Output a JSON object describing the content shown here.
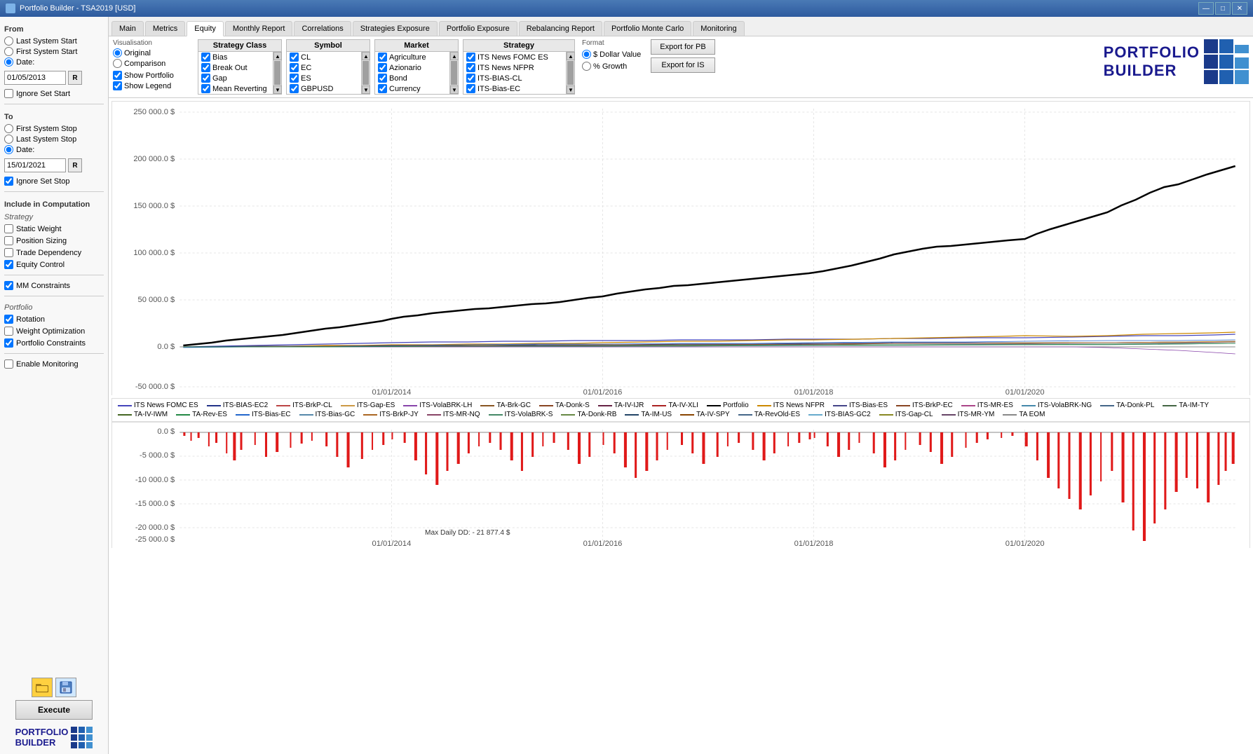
{
  "app": {
    "title": "Portfolio Builder - TSA2019 [USD]",
    "icon": "📊"
  },
  "titlebar": {
    "minimize": "—",
    "maximize": "□",
    "close": "✕"
  },
  "tabs": [
    {
      "label": "Main",
      "active": false
    },
    {
      "label": "Metrics",
      "active": false
    },
    {
      "label": "Equity",
      "active": true
    },
    {
      "label": "Monthly Report",
      "active": false
    },
    {
      "label": "Correlations",
      "active": false
    },
    {
      "label": "Strategies Exposure",
      "active": false
    },
    {
      "label": "Portfolio Exposure",
      "active": false
    },
    {
      "label": "Rebalancing Report",
      "active": false
    },
    {
      "label": "Portfolio Monte Carlo",
      "active": false
    },
    {
      "label": "Monitoring",
      "active": false
    }
  ],
  "left": {
    "from_label": "From",
    "from_options": [
      {
        "label": "Last System Start",
        "checked": true
      },
      {
        "label": "First System Start",
        "checked": false
      },
      {
        "label": "Date:",
        "checked": false
      }
    ],
    "from_date": "01/05/2013",
    "ignore_set_start": "Ignore Set Start",
    "to_label": "To",
    "to_options": [
      {
        "label": "First System Stop",
        "checked": false
      },
      {
        "label": "Last System Stop",
        "checked": false
      },
      {
        "label": "Date:",
        "checked": true
      }
    ],
    "to_date": "15/01/2021",
    "ignore_set_stop": "Ignore Set Stop",
    "include_label": "Include in Computation",
    "strategy_label": "Strategy",
    "strategy_items": [
      {
        "label": "Static Weight",
        "checked": false
      },
      {
        "label": "Position Sizing",
        "checked": false
      },
      {
        "label": "Trade Dependency",
        "checked": false
      },
      {
        "label": "Equity Control",
        "checked": true
      }
    ],
    "mm_label": "MM Constraints",
    "mm_checked": true,
    "portfolio_label": "Portfolio",
    "portfolio_items": [
      {
        "label": "Rotation",
        "checked": true
      },
      {
        "label": "Weight Optimization",
        "checked": false
      },
      {
        "label": "Portfolio Constraints",
        "checked": true
      }
    ],
    "enable_monitoring": "Enable Monitoring",
    "enable_monitoring_checked": false,
    "execute_btn": "Execute"
  },
  "toolbar": {
    "vis_label": "Visualisation",
    "vis_radios": [
      {
        "label": "Original",
        "checked": true
      },
      {
        "label": "Comparison",
        "checked": false
      }
    ],
    "vis_checks": [
      {
        "label": "Show Portfolio",
        "checked": true
      },
      {
        "label": "Show Legend",
        "checked": true
      }
    ],
    "strategy_class": {
      "header": "Strategy Class",
      "items": [
        {
          "label": "Bias",
          "checked": true
        },
        {
          "label": "Break Out",
          "checked": true
        },
        {
          "label": "Gap",
          "checked": true
        },
        {
          "label": "Mean Reverting",
          "checked": true
        }
      ]
    },
    "symbol": {
      "header": "Symbol",
      "items": [
        {
          "label": "CL",
          "checked": true
        },
        {
          "label": "EC",
          "checked": true
        },
        {
          "label": "ES",
          "checked": true
        },
        {
          "label": "GBPUSD",
          "checked": true
        }
      ]
    },
    "market": {
      "header": "Market",
      "items": [
        {
          "label": "Agriculture",
          "checked": true
        },
        {
          "label": "Azionario",
          "checked": true
        },
        {
          "label": "Bond",
          "checked": true
        },
        {
          "label": "Currency",
          "checked": true
        }
      ]
    },
    "strategy": {
      "header": "Strategy",
      "items": [
        {
          "label": "ITS News FOMC ES",
          "checked": true
        },
        {
          "label": "ITS News NFPR",
          "checked": true
        },
        {
          "label": "ITS-BIAS-CL",
          "checked": true
        },
        {
          "label": "ITS-Bias-EC",
          "checked": true
        }
      ]
    },
    "format_label": "Format",
    "format_radios": [
      {
        "label": "$ Dollar Value",
        "checked": true
      },
      {
        "label": "% Growth",
        "checked": false
      }
    ],
    "export_pb": "Export for PB",
    "export_is": "Export for IS"
  },
  "chart": {
    "y_labels": [
      "250 000.0 $",
      "200 000.0 $",
      "150 000.0 $",
      "100 000.0 $",
      "50 000.0 $",
      "0.0 $",
      "-50 000.0 $"
    ],
    "x_labels": [
      "01/01/2014",
      "01/01/2016",
      "01/01/2018",
      "01/01/2020"
    ],
    "dd_y_labels": [
      "0.0 $",
      "-5 000.0 $",
      "-10 000.0 $",
      "-15 000.0 $",
      "-20 000.0 $",
      "-25 000.0 $"
    ],
    "max_dd": "Max Daily DD: - 21 877.4 $"
  },
  "legend": {
    "items": [
      {
        "label": "ITS News FOMC ES",
        "color": "#4444bb"
      },
      {
        "label": "ITS News NFPR",
        "color": "#cc8800"
      },
      {
        "label": "ITS-Bias-EC",
        "color": "#2266cc"
      },
      {
        "label": "ITS-BIAS-EC2",
        "color": "#223388"
      },
      {
        "label": "ITS-Bias-ES",
        "color": "#444488"
      },
      {
        "label": "ITS-Bias-GC",
        "color": "#5588aa"
      },
      {
        "label": "ITS-BIAS-GC2",
        "color": "#66aacc"
      },
      {
        "label": "ITS-BrkP-CL",
        "color": "#bb4444"
      },
      {
        "label": "ITS-BrkP-EC",
        "color": "#884422"
      },
      {
        "label": "ITS-BrkP-JY",
        "color": "#aa6622"
      },
      {
        "label": "ITS-Gap-ES",
        "color": "#cc9944"
      },
      {
        "label": "ITS-Gap-CL",
        "color": "#888822"
      },
      {
        "label": "ITS-MR-ES",
        "color": "#aa4488"
      },
      {
        "label": "ITS-MR-NQ",
        "color": "#884466"
      },
      {
        "label": "ITS-MR-YM",
        "color": "#664466"
      },
      {
        "label": "ITS-VolaBRK-LH",
        "color": "#8844aa"
      },
      {
        "label": "ITS-VolaBRK-NG",
        "color": "#4488aa"
      },
      {
        "label": "ITS-VolaBRK-S",
        "color": "#448866"
      },
      {
        "label": "TA EOM",
        "color": "#888888"
      },
      {
        "label": "TA-Brk-GC",
        "color": "#885522"
      },
      {
        "label": "TA-Donk-PL",
        "color": "#446688"
      },
      {
        "label": "TA-Donk-RB",
        "color": "#668844"
      },
      {
        "label": "TA-Donk-S",
        "color": "#884422"
      },
      {
        "label": "TA-IM-TY",
        "color": "#446644"
      },
      {
        "label": "TA-IM-US",
        "color": "#224466"
      },
      {
        "label": "TA-IV-IJR",
        "color": "#662244"
      },
      {
        "label": "TA-IV-IWM",
        "color": "#446622"
      },
      {
        "label": "TA-IV-SPY",
        "color": "#884400"
      },
      {
        "label": "TA-IV-XLI",
        "color": "#aa2222"
      },
      {
        "label": "TA-Rev-ES",
        "color": "#228844"
      },
      {
        "label": "TA-RevOld-ES",
        "color": "#446688"
      },
      {
        "label": "Portfolio",
        "color": "#000000"
      }
    ]
  },
  "logo": {
    "line1": "PORTFOLIO",
    "line2": "BUILDER",
    "grid_colors": [
      "#1a3a8a",
      "#2060b0",
      "#4090d0",
      "#1a3a8a",
      "#2060b0",
      "#4090d0",
      "#1a3a8a",
      "#2060b0",
      "#4090d0"
    ]
  }
}
